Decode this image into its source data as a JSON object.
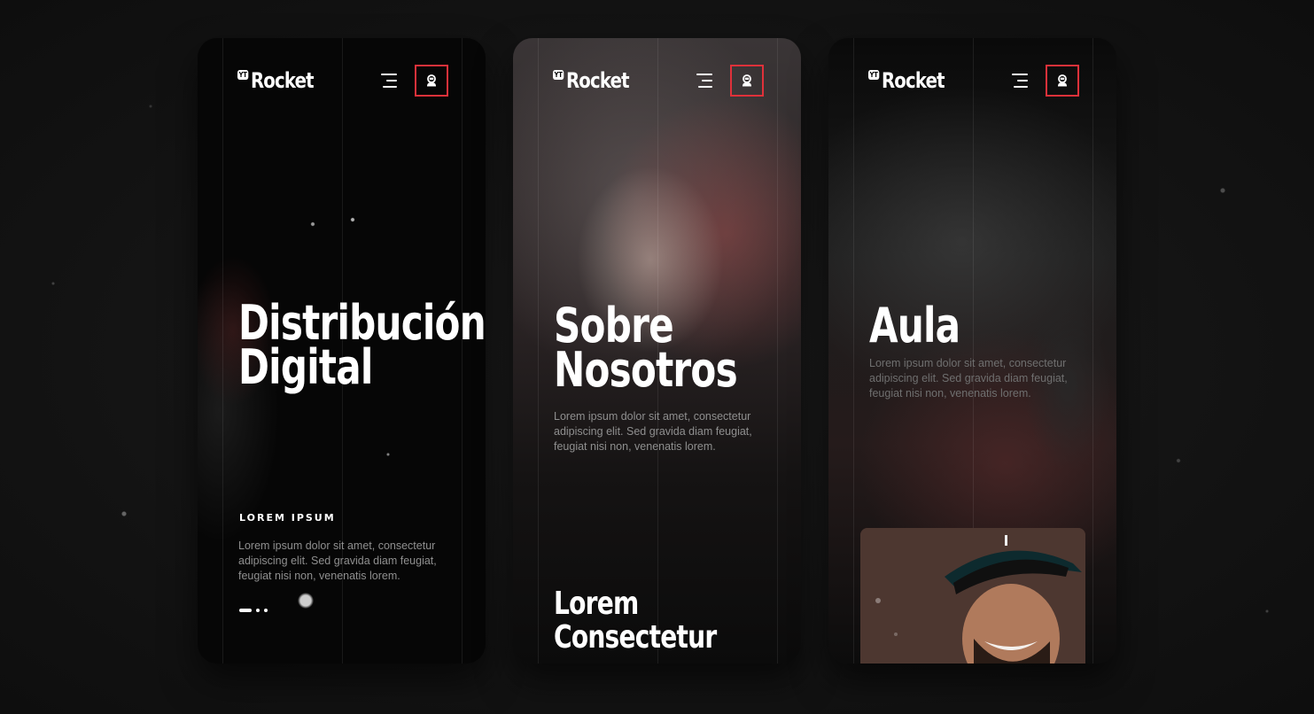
{
  "screens": [
    {
      "logo": {
        "badge": "YT",
        "text": "Rocket"
      },
      "title_line1": "Distribución",
      "title_line2": "Digital",
      "eyebrow": "LOREM IPSUM",
      "body": "Lorem ipsum dolor sit amet, consectetur adipiscing elit. Sed gravida diam feugiat, feugiat nisi non, venenatis lorem."
    },
    {
      "logo": {
        "badge": "YT",
        "text": "Rocket"
      },
      "title_line1": "Sobre",
      "title_line2": "Nosotros",
      "body": "Lorem ipsum dolor sit amet, consectetur adipiscing elit. Sed gravida diam feugiat, feugiat nisi non, venenatis lorem.",
      "sub_title_line1": "Lorem",
      "sub_title_line2": "Consectetur"
    },
    {
      "logo": {
        "badge": "YT",
        "text": "Rocket"
      },
      "title_line1": "Aula",
      "body": "Lorem ipsum dolor sit amet, consectetur adipiscing elit. Sed gravida diam feugiat, feugiat nisi non, venenatis lorem."
    }
  ],
  "icons": {
    "menu": "hamburger-menu-icon",
    "user": "astronaut-user-icon"
  },
  "colors": {
    "accent": "#e0313a",
    "background": "#141414",
    "text": "#ffffff",
    "muted_text": "#8f8f8f"
  }
}
